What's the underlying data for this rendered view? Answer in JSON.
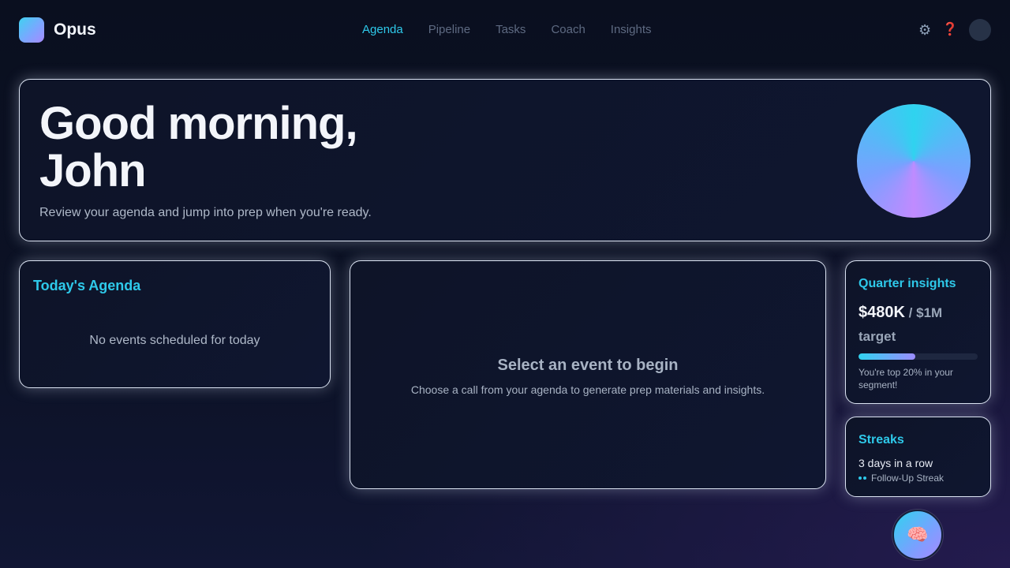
{
  "app": {
    "name": "Opus"
  },
  "nav": {
    "items": [
      {
        "label": "Agenda",
        "active": true
      },
      {
        "label": "Pipeline",
        "active": false
      },
      {
        "label": "Tasks",
        "active": false
      },
      {
        "label": "Coach",
        "active": false
      },
      {
        "label": "Insights",
        "active": false
      }
    ]
  },
  "header": {
    "icons": {
      "settings": "gear-icon",
      "help": "help-icon"
    },
    "settings_glyph": "⚙",
    "help_glyph": "❓"
  },
  "hero": {
    "title_line1": "Good morning,",
    "title_line2": "John",
    "subtitle": "Review your agenda and jump into prep when you're ready."
  },
  "agenda": {
    "title": "Today's Agenda",
    "empty_message": "No events scheduled for today"
  },
  "workspace": {
    "title": "Select an event to begin",
    "subtitle": "Choose a call from your agenda to generate prep materials and insights."
  },
  "insights": {
    "title": "Quarter insights",
    "amount": "$480K",
    "separator": " / ",
    "goal": "$1M",
    "goal_suffix": "target",
    "progress_fraction": 0.48,
    "note": "You're top 20% in your segment!"
  },
  "streaks": {
    "title": "Streaks",
    "count": "3 days in a row",
    "label": "Follow-Up Streak"
  },
  "fab": {
    "icon": "brain-icon",
    "glyph": "🧠"
  },
  "colors": {
    "accent": "#2ec9ea",
    "background": "#0a0f1f",
    "nav_inactive": "#5e6a82",
    "help": "#e0434b"
  }
}
